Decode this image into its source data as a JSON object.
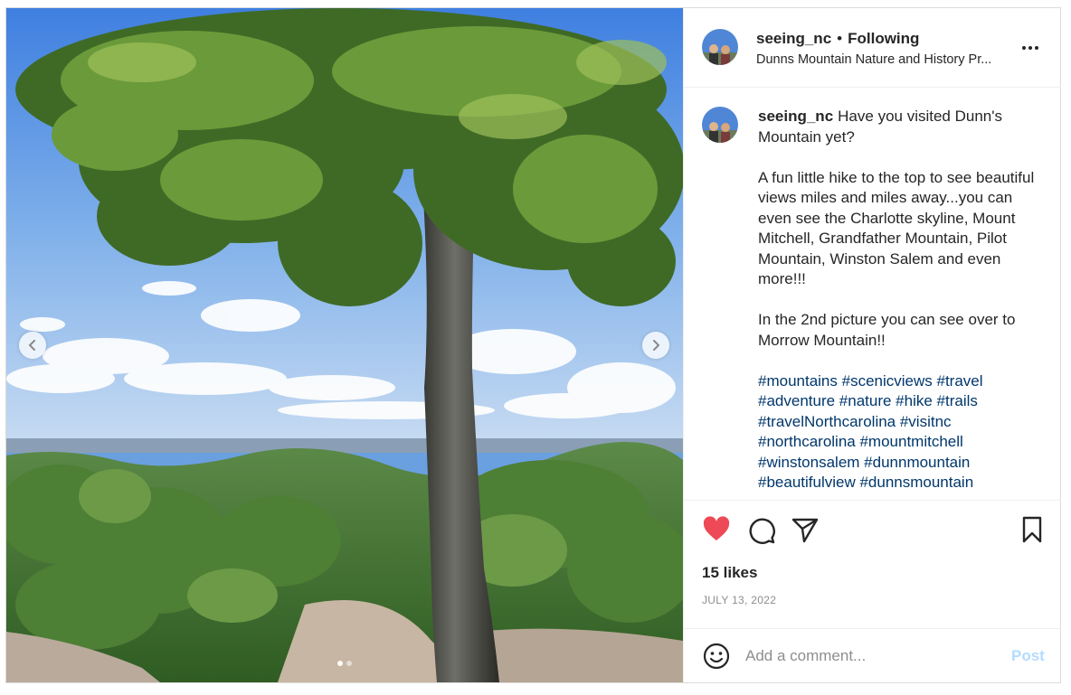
{
  "post": {
    "username": "seeing_nc",
    "separator": "•",
    "follow_status": "Following",
    "location": "Dunns Mountain Nature and History Pr...",
    "caption_intro": "Have you visited Dunn's Mountain yet?",
    "caption_body": "A fun little hike to the top to see beautiful views miles and miles away...you can even see the Charlotte skyline, Mount Mitchell, Grandfather Mountain, Pilot Mountain, Winston Salem and even more!!!",
    "caption_body2": "In the 2nd picture you can see over to Morrow Mountain!!",
    "hashtags": "#mountains #scenicviews #travel #adventure #nature #hike #trails #travelNorthcarolina #visitnc #northcarolina #mountmitchell #winstonsalem #dunnmountain #beautifulview #dunnsmountain",
    "likes": "15 likes",
    "date": "JULY 13, 2022"
  },
  "comment_box": {
    "placeholder": "Add a comment...",
    "post_label": "Post"
  },
  "carousel": {
    "current_slide": 1,
    "total_slides": 2
  },
  "icons": {
    "like": "heart-icon",
    "comment": "comment-icon",
    "share": "share-icon",
    "save": "bookmark-icon",
    "more": "more-options-icon",
    "emoji": "emoji-icon",
    "prev": "chevron-left-icon",
    "next": "chevron-right-icon"
  },
  "colors": {
    "like_active": "#ed4956",
    "post_button_disabled": "#b3dbff",
    "hashtag": "#00376b",
    "muted_text": "#8e8e8e"
  }
}
